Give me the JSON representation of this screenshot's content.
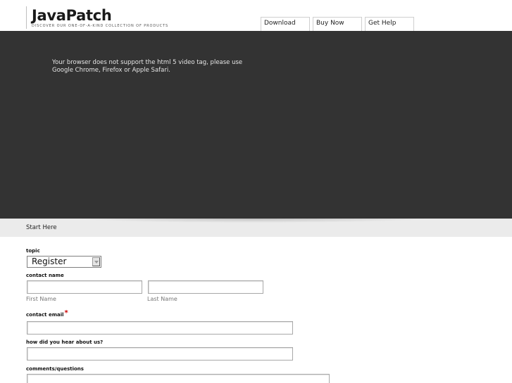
{
  "header": {
    "logo": "JavaPatch",
    "tagline": "DISCOVER OUR ONE-OF-A-KIND COLLECTION OF PRODUCTS",
    "nav": [
      "Download",
      "Buy Now",
      "Get Help"
    ]
  },
  "video": {
    "fallback_line1": "Your browser does not support the html 5 video tag, please use",
    "fallback_line2": "Google Chrome, Firefox or Apple Safari."
  },
  "start": {
    "label": "Start Here"
  },
  "form": {
    "topic_label": "topic",
    "topic_value": "Register",
    "contact_name_label": "contact name",
    "first_name_hint": "First Name",
    "last_name_hint": "Last Name",
    "email_label": "contact email",
    "required_mark": "*",
    "referral_label": "how did you hear about us?",
    "comments_label": "comments/questions"
  },
  "colors": {
    "video_bg": "#333333",
    "start_bar_bg": "#ebebeb",
    "required": "#cc0000"
  }
}
